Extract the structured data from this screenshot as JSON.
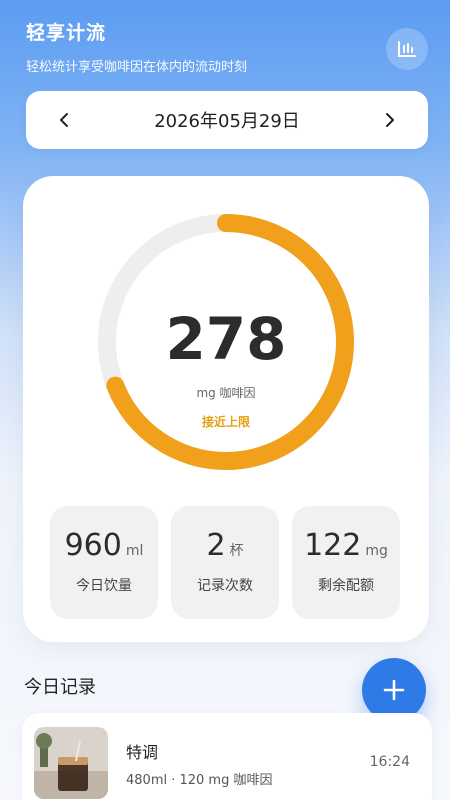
{
  "header": {
    "title": "轻享计流",
    "subtitle": "轻松统计享受咖啡因在体内的流动时刻"
  },
  "stats_button": {
    "icon": "bar-chart-icon"
  },
  "date_nav": {
    "date": "2026年05月29日",
    "prev_icon": "chevron-left-icon",
    "next_icon": "chevron-right-icon"
  },
  "summary": {
    "caffeine_value": "278",
    "caffeine_unit": "mg 咖啡因",
    "status": "接近上限",
    "progress_fraction": 0.69,
    "colors": {
      "progress": "#f0a01a",
      "track": "#eeeeee"
    }
  },
  "stats": [
    {
      "value": "960",
      "unit": "ml",
      "label": "今日饮量"
    },
    {
      "value": "2",
      "unit": "杯",
      "label": "记录次数"
    },
    {
      "value": "122",
      "unit": "mg",
      "label": "剩余配额"
    }
  ],
  "records": {
    "title": "今日记录",
    "add_icon": "plus-icon",
    "items": [
      {
        "name": "特调",
        "detail": "480ml · 120 mg 咖啡因",
        "time": "16:24",
        "thumbnail": "coffee-glass-image"
      }
    ]
  },
  "colors": {
    "accent": "#2e7be8",
    "warning": "#e6a017"
  }
}
